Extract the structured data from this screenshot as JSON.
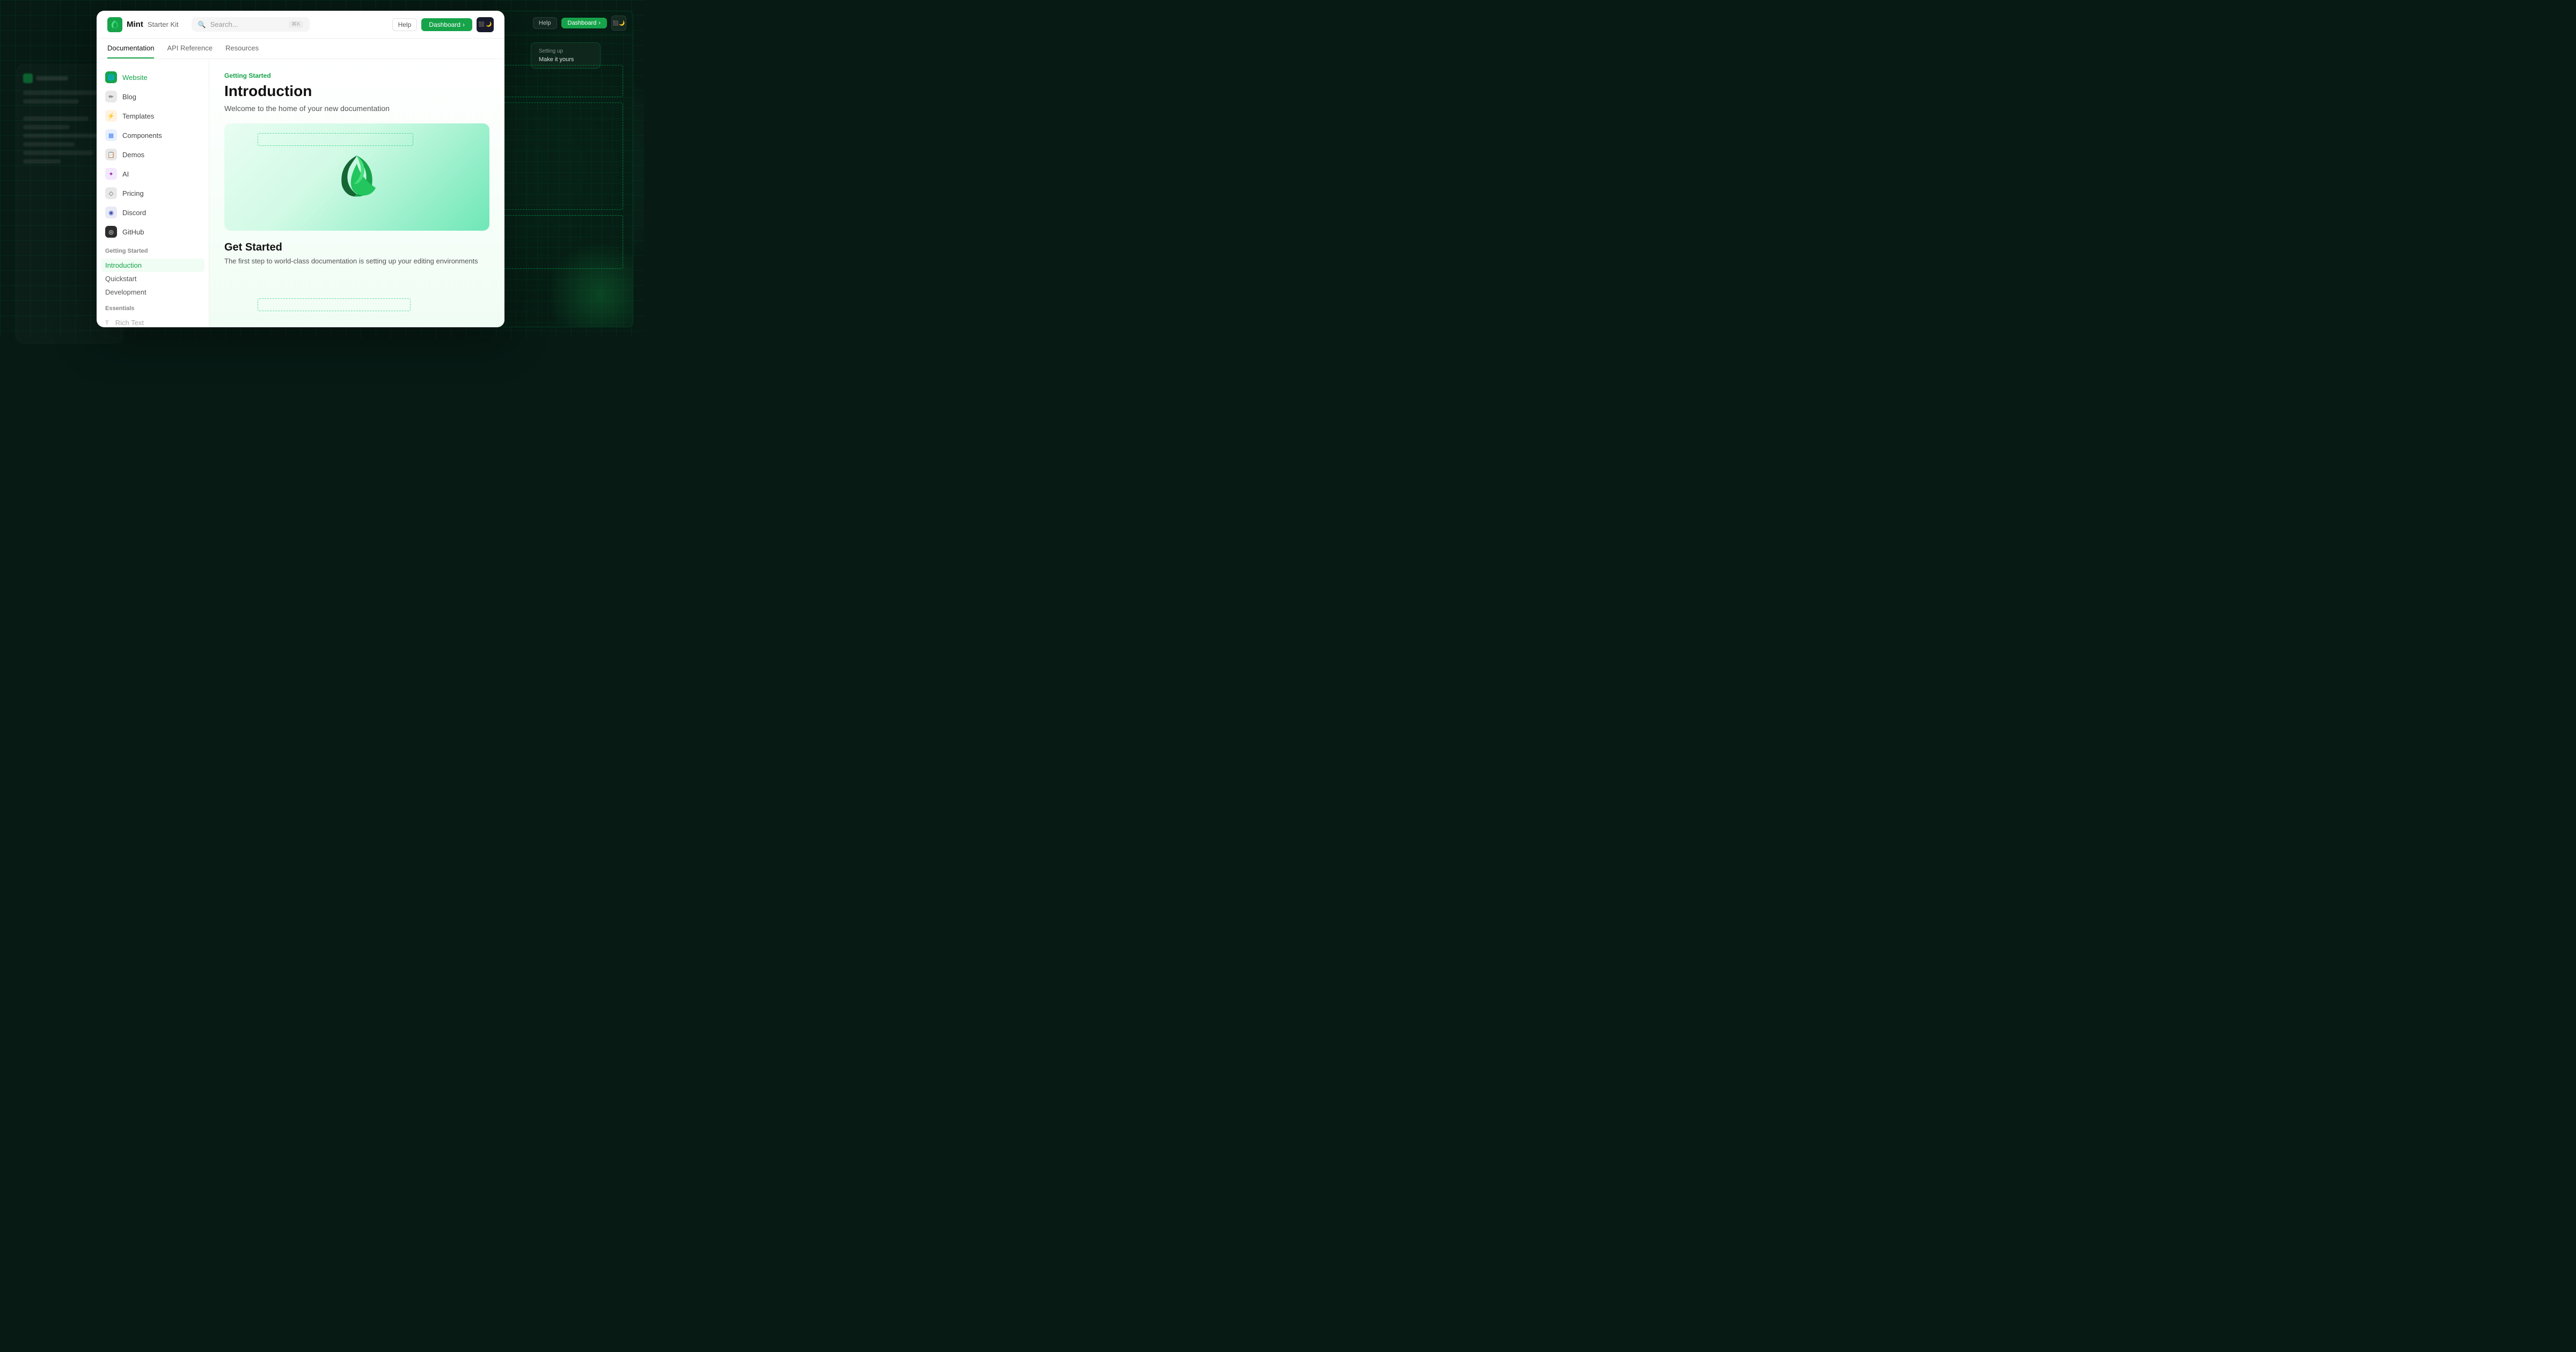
{
  "background": {
    "color": "#071a14"
  },
  "header": {
    "logo_text": "Mint",
    "logo_subtitle": "Starter Kit",
    "search_placeholder": "Search...",
    "search_kbd": "⌘K",
    "help_label": "Help",
    "dashboard_label": "Dashboard",
    "dashboard_arrow": "›"
  },
  "nav_tabs": [
    {
      "label": "Documentation",
      "active": true
    },
    {
      "label": "API Reference",
      "active": false
    },
    {
      "label": "Resources",
      "active": false
    }
  ],
  "sidebar": {
    "nav_items": [
      {
        "label": "Website",
        "icon": "🌐",
        "icon_class": "green",
        "active": true
      },
      {
        "label": "Blog",
        "icon": "✏",
        "icon_class": "gray"
      },
      {
        "label": "Templates",
        "icon": "⚡",
        "icon_class": "orange"
      },
      {
        "label": "Components",
        "icon": "▦",
        "icon_class": "blue"
      },
      {
        "label": "Demos",
        "icon": "📋",
        "icon_class": "gray"
      },
      {
        "label": "AI",
        "icon": "✦",
        "icon_class": "purple"
      },
      {
        "label": "Pricing",
        "icon": "◇",
        "icon_class": "gray"
      },
      {
        "label": "Discord",
        "icon": "◉",
        "icon_class": "indigo"
      },
      {
        "label": "GitHub",
        "icon": "◎",
        "icon_class": "dark"
      }
    ],
    "sections": [
      {
        "title": "Getting Started",
        "links": [
          {
            "label": "Introduction",
            "active": true
          },
          {
            "label": "Quickstart",
            "active": false
          },
          {
            "label": "Development",
            "active": false
          }
        ]
      },
      {
        "title": "Essentials",
        "links": [
          {
            "label": "Rich Text",
            "active": false,
            "icon": "T",
            "dimmed": true
          }
        ]
      }
    ]
  },
  "main_content": {
    "getting_started_label": "Getting Started",
    "page_title": "Introduction",
    "page_subtitle": "Welcome to the home of your new documentation",
    "get_started_title": "Get Started",
    "get_started_desc": "The first step to world-class documentation is setting up your editing environments"
  },
  "right_panel": {
    "help_label": "Help",
    "dashboard_label": "Dashboard",
    "setting_up_label": "Setting up",
    "make_it_yours_label": "Make it yours"
  }
}
